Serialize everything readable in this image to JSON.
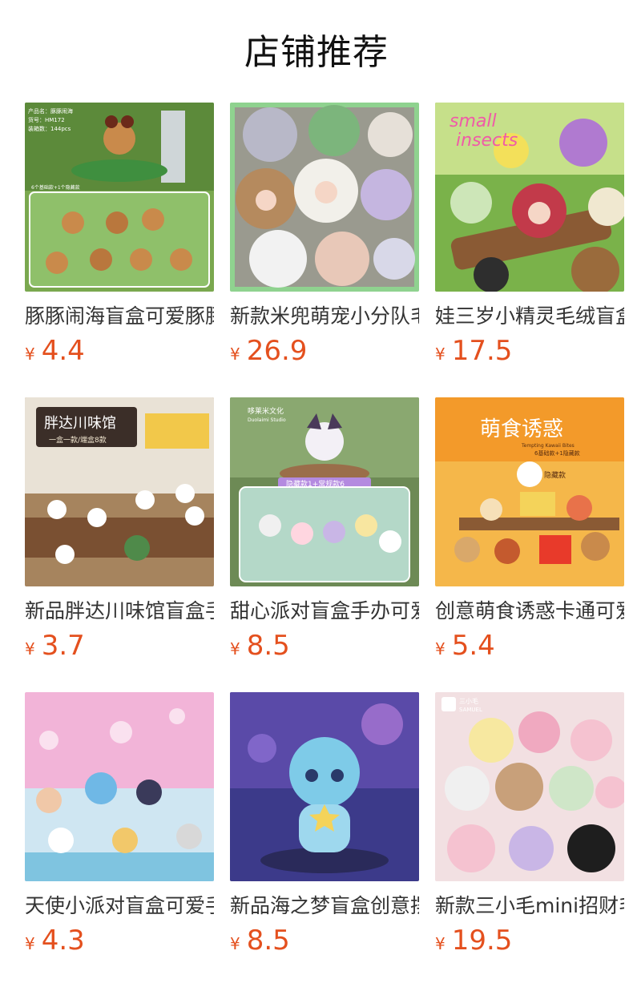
{
  "page": {
    "title": "店铺推荐"
  },
  "products": [
    {
      "name": "豚豚闹海盲盒可爱豚豚公仔",
      "currency": "¥",
      "price": "4.4",
      "image_text": [
        "产品名：豚豚闹海",
        "货号：HM172",
        "装箱数：144pcs",
        "6个基础款+1个隐藏款"
      ],
      "colors": {
        "bg": "#6f9c4a",
        "accent": "#c98a4b",
        "top": "#3a6a2a"
      }
    },
    {
      "name": "新款米兜萌宠小分队毛绒盲盒",
      "currency": "¥",
      "price": "26.9",
      "image_text": [],
      "colors": {
        "bg": "#8fd28f",
        "accent": "#d9d9e6",
        "top": "#b58a5e"
      }
    },
    {
      "name": "娃三岁小精灵毛绒盲盒挂件",
      "currency": "¥",
      "price": "17.5",
      "image_text": [
        "small",
        "insects"
      ],
      "colors": {
        "bg": "#7ab24a",
        "accent": "#c23a4a",
        "top": "#9a6b3c"
      }
    },
    {
      "name": "新品胖达川味馆盲盒手办",
      "currency": "¥",
      "price": "3.7",
      "image_text": [
        "胖达川味馆",
        "一盒一款/端盒8款"
      ],
      "colors": {
        "bg": "#8a6b4a",
        "accent": "#3d3d3d",
        "top": "#f1e6d0"
      }
    },
    {
      "name": "甜心派对盲盒手办可爱摆件",
      "currency": "¥",
      "price": "8.5",
      "image_text": [
        "哆莱米文化",
        "Duolaimi Studio",
        "隐藏款1+常规款6"
      ],
      "colors": {
        "bg": "#6d8a55",
        "accent": "#c9b6e6",
        "top": "#f0c9d8"
      }
    },
    {
      "name": "创意萌食诱惑卡通可爱摆件",
      "currency": "¥",
      "price": "5.4",
      "image_text": [
        "萌食诱惑",
        "Tempting Kawaii Bites",
        "6基础款+1隐藏款",
        "隐藏款"
      ],
      "colors": {
        "bg": "#f3a12e",
        "accent": "#c45a2e",
        "top": "#fce6b8"
      }
    },
    {
      "name": "天使小派对盲盒可爱手办",
      "currency": "¥",
      "price": "4.3",
      "image_text": [],
      "colors": {
        "bg": "#f2b4d8",
        "accent": "#6fb8e6",
        "top": "#bfe3f2"
      }
    },
    {
      "name": "新品海之梦盲盒创意摆件",
      "currency": "¥",
      "price": "8.5",
      "image_text": [],
      "colors": {
        "bg": "#3c3a8a",
        "accent": "#7ecbe8",
        "top": "#b07ad8"
      }
    },
    {
      "name": "新款三小毛mini招财毛绒挂件",
      "currency": "¥",
      "price": "19.5",
      "image_text": [
        "三小毛",
        "SAMUEL"
      ],
      "colors": {
        "bg": "#f2e0e2",
        "accent": "#f0a9c0",
        "top": "#e9d4c2"
      }
    }
  ]
}
